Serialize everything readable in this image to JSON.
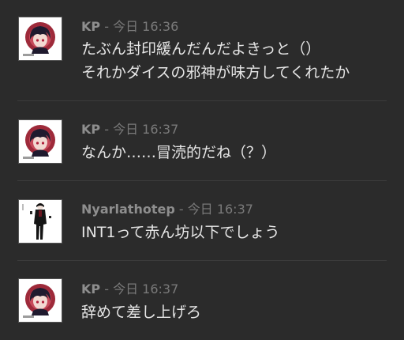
{
  "messages": [
    {
      "author": "KP",
      "separator": " - ",
      "time": "今日 16:36",
      "lines": [
        "たぶん封印緩んだんだよきっと（）",
        "それかダイスの邪神が味方してくれたか"
      ],
      "avatar": "kp-avatar"
    },
    {
      "author": "KP",
      "separator": " - ",
      "time": "今日 16:37",
      "lines": [
        "なんか……冒涜的だね（？）"
      ],
      "avatar": "kp-avatar"
    },
    {
      "author": "Nyarlathotep",
      "separator": " - ",
      "time": "今日 16:37",
      "lines": [
        "INT1って赤ん坊以下でしょう"
      ],
      "avatar": "nyarlathotep-avatar"
    },
    {
      "author": "KP",
      "separator": " - ",
      "time": "今日 16:37",
      "lines": [
        "辞めて差し上げろ"
      ],
      "avatar": "kp-avatar"
    }
  ],
  "colors": {
    "background": "#2b2b2b",
    "author": "#8e8e8e",
    "timestamp": "#7a7a7a",
    "message_text": "#e6e6e6",
    "divider": "#3c3c3c",
    "avatar_accent": "#9e2a3a"
  }
}
